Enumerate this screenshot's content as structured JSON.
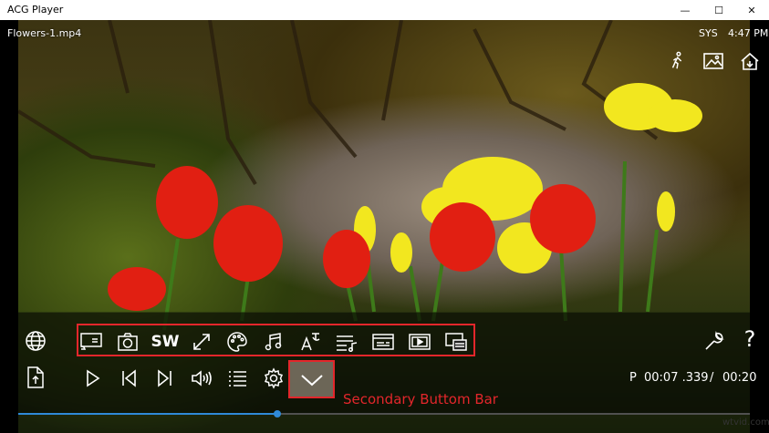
{
  "window": {
    "title": "ACG Player",
    "controls": {
      "minimize": "—",
      "maximize": "☐",
      "close": "✕"
    }
  },
  "video": {
    "file_name": "Flowers-1.mp4",
    "status": "SYS",
    "clock": "4:47 PM"
  },
  "top_icons": [
    "person-walk-icon",
    "image-icon",
    "home-download-icon"
  ],
  "secondary_bar": {
    "left_icon": "globe-icon",
    "items": [
      {
        "name": "cast-icon"
      },
      {
        "name": "camera-icon"
      },
      {
        "name": "sw-text",
        "label": "SW"
      },
      {
        "name": "fullscreen-icon"
      },
      {
        "name": "palette-icon"
      },
      {
        "name": "music-note-icon"
      },
      {
        "name": "font-subtitle-icon"
      },
      {
        "name": "playlist-music-icon"
      },
      {
        "name": "caption-icon"
      },
      {
        "name": "video-frame-icon"
      },
      {
        "name": "pip-icon"
      }
    ],
    "right_icons": [
      "wrench-icon",
      "help-icon"
    ],
    "help_label": "?"
  },
  "primary_bar": {
    "items": [
      "open-file-icon",
      "play-icon",
      "previous-icon",
      "next-icon",
      "volume-icon",
      "list-icon",
      "settings-icon",
      "chevron-down-icon"
    ]
  },
  "time": {
    "prefix": "P",
    "current": "00:07 .339",
    "separator": "/",
    "duration": "00:20"
  },
  "progress": {
    "fraction": 0.354
  },
  "annotation": {
    "label": "Secondary Buttom Bar"
  },
  "colors": {
    "accent": "#2f8ad8",
    "annotation": "#e3262b"
  },
  "watermark": "wtvid.com"
}
